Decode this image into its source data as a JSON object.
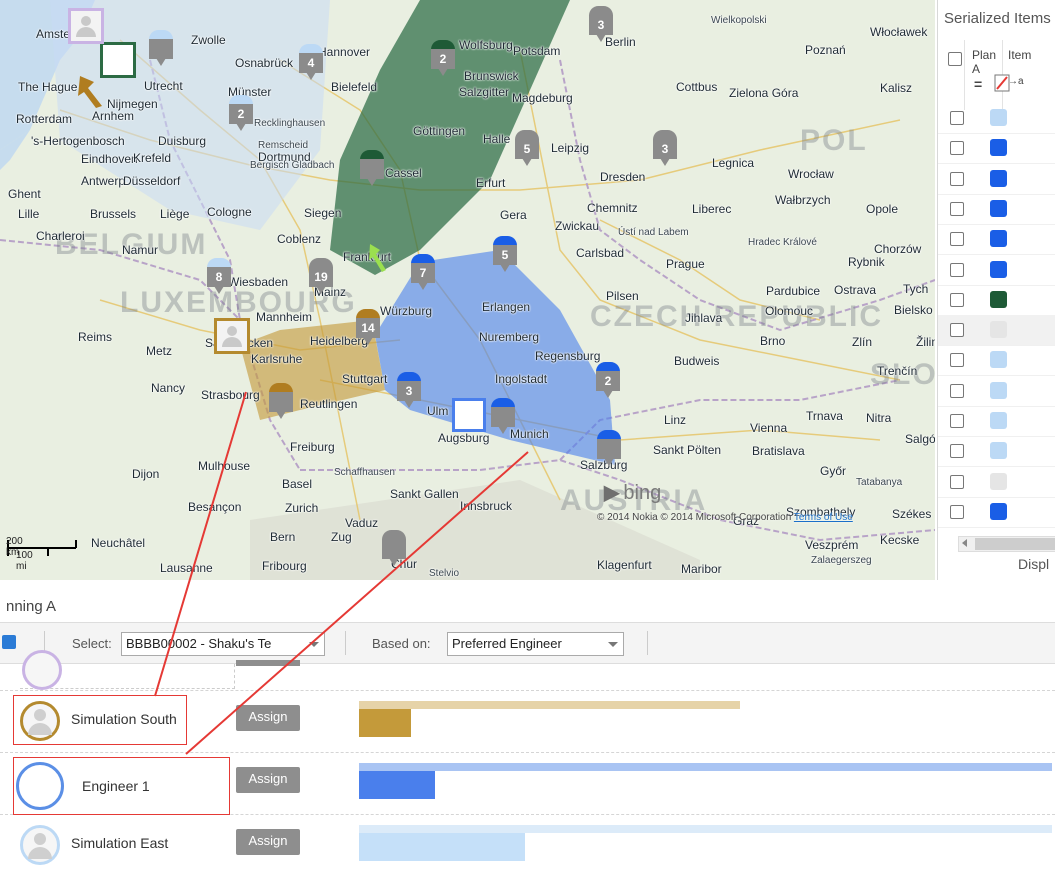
{
  "map": {
    "countries": [
      "BELGIUM",
      "LUXEMBOURG",
      "CZECH REPUBLIC",
      "AUSTRIA",
      "POL",
      "SLOV"
    ],
    "cities": [
      {
        "name": "Amsterdam",
        "cls": ""
      },
      {
        "name": "Zwolle",
        "cls": ""
      },
      {
        "name": "The Hague",
        "cls": ""
      },
      {
        "name": "Utrecht",
        "cls": ""
      },
      {
        "name": "Nijmegen",
        "cls": ""
      },
      {
        "name": "Rotterdam",
        "cls": ""
      },
      {
        "name": "Arnhem",
        "cls": ""
      },
      {
        "name": "Osnabrück",
        "cls": ""
      },
      {
        "name": "Hannover",
        "cls": ""
      },
      {
        "name": "Bielefeld",
        "cls": ""
      },
      {
        "name": "Münster",
        "cls": ""
      },
      {
        "name": "Wolfsburg",
        "cls": ""
      },
      {
        "name": "Potsdam",
        "cls": ""
      },
      {
        "name": "Berlin",
        "cls": ""
      },
      {
        "name": "Brunswick",
        "cls": ""
      },
      {
        "name": "Salzgitter",
        "cls": ""
      },
      {
        "name": "Magdeburg",
        "cls": ""
      },
      {
        "name": "Poznań",
        "cls": ""
      },
      {
        "name": "Włocławek",
        "cls": ""
      },
      {
        "name": "Wielkopolski",
        "cls": "small"
      },
      {
        "name": "Zielona Góra",
        "cls": ""
      },
      {
        "name": "Kalisz",
        "cls": ""
      },
      {
        "name": "Cottbus",
        "cls": ""
      },
      {
        "name": "'s-Hertogenbosch",
        "cls": ""
      },
      {
        "name": "Duisburg",
        "cls": ""
      },
      {
        "name": "Recklinghausen",
        "cls": "small"
      },
      {
        "name": "Göttingen",
        "cls": ""
      },
      {
        "name": "Halle",
        "cls": ""
      },
      {
        "name": "Leipzig",
        "cls": ""
      },
      {
        "name": "Eindhoven",
        "cls": ""
      },
      {
        "name": "Krefeld",
        "cls": ""
      },
      {
        "name": "Dortmund",
        "cls": ""
      },
      {
        "name": "Remscheid",
        "cls": "small"
      },
      {
        "name": "Cassel",
        "cls": ""
      },
      {
        "name": "Erfurt",
        "cls": ""
      },
      {
        "name": "Dresden",
        "cls": ""
      },
      {
        "name": "Legnica",
        "cls": ""
      },
      {
        "name": "Wrocław",
        "cls": ""
      },
      {
        "name": "Antwerp",
        "cls": ""
      },
      {
        "name": "Düsseldorf",
        "cls": ""
      },
      {
        "name": "Bergisch Gladbach",
        "cls": "small"
      },
      {
        "name": "Ghent",
        "cls": ""
      },
      {
        "name": "Lille",
        "cls": ""
      },
      {
        "name": "Brussels",
        "cls": ""
      },
      {
        "name": "Liège",
        "cls": ""
      },
      {
        "name": "Cologne",
        "cls": ""
      },
      {
        "name": "Siegen",
        "cls": ""
      },
      {
        "name": "Gera",
        "cls": ""
      },
      {
        "name": "Chemnitz",
        "cls": ""
      },
      {
        "name": "Liberec",
        "cls": ""
      },
      {
        "name": "Wałbrzych",
        "cls": ""
      },
      {
        "name": "Opole",
        "cls": ""
      },
      {
        "name": "Charleroi",
        "cls": ""
      },
      {
        "name": "Namur",
        "cls": ""
      },
      {
        "name": "Coblenz",
        "cls": ""
      },
      {
        "name": "Zwickau",
        "cls": ""
      },
      {
        "name": "Ústí nad Labem",
        "cls": "small"
      },
      {
        "name": "Hradec Králové",
        "cls": "small"
      },
      {
        "name": "Chorzów",
        "cls": ""
      },
      {
        "name": "Rybnik",
        "cls": ""
      },
      {
        "name": "Carlsbad",
        "cls": ""
      },
      {
        "name": "Prague",
        "cls": ""
      },
      {
        "name": "Wiesbaden",
        "cls": ""
      },
      {
        "name": "Mainz",
        "cls": ""
      },
      {
        "name": "Frankfurt",
        "cls": ""
      },
      {
        "name": "Pardubice",
        "cls": ""
      },
      {
        "name": "Ostrava",
        "cls": ""
      },
      {
        "name": "Tych",
        "cls": ""
      },
      {
        "name": "Würzburg",
        "cls": ""
      },
      {
        "name": "Erlangen",
        "cls": ""
      },
      {
        "name": "Pilsen",
        "cls": ""
      },
      {
        "name": "Olomouc",
        "cls": ""
      },
      {
        "name": "Bielsko",
        "cls": ""
      },
      {
        "name": "Mannheim",
        "cls": ""
      },
      {
        "name": "Heidelberg",
        "cls": ""
      },
      {
        "name": "Nuremberg",
        "cls": ""
      },
      {
        "name": "Jihlava",
        "cls": ""
      },
      {
        "name": "Brno",
        "cls": ""
      },
      {
        "name": "Zlín",
        "cls": ""
      },
      {
        "name": "Žilin",
        "cls": ""
      },
      {
        "name": "Reims",
        "cls": ""
      },
      {
        "name": "Metz",
        "cls": ""
      },
      {
        "name": "Saarbrücken",
        "cls": ""
      },
      {
        "name": "Karlsruhe",
        "cls": ""
      },
      {
        "name": "Regensburg",
        "cls": ""
      },
      {
        "name": "Budweis",
        "cls": ""
      },
      {
        "name": "Nancy",
        "cls": ""
      },
      {
        "name": "Strasbourg",
        "cls": ""
      },
      {
        "name": "Stuttgart",
        "cls": ""
      },
      {
        "name": "Ingolstadt",
        "cls": ""
      },
      {
        "name": "Trenčín",
        "cls": ""
      },
      {
        "name": "Reutlingen",
        "cls": ""
      },
      {
        "name": "Ulm",
        "cls": ""
      },
      {
        "name": "Linz",
        "cls": ""
      },
      {
        "name": "Trnava",
        "cls": ""
      },
      {
        "name": "Nitra",
        "cls": ""
      },
      {
        "name": "Vienna",
        "cls": ""
      },
      {
        "name": "Salgó",
        "cls": ""
      },
      {
        "name": "Augsburg",
        "cls": ""
      },
      {
        "name": "Munich",
        "cls": ""
      },
      {
        "name": "Freiburg",
        "cls": ""
      },
      {
        "name": "Sankt Pölten",
        "cls": ""
      },
      {
        "name": "Bratislava",
        "cls": ""
      },
      {
        "name": "Mulhouse",
        "cls": ""
      },
      {
        "name": "Schaffhausen",
        "cls": "small"
      },
      {
        "name": "Salzburg",
        "cls": ""
      },
      {
        "name": "Győr",
        "cls": ""
      },
      {
        "name": "Tatabanya",
        "cls": "small"
      },
      {
        "name": "Dijon",
        "cls": ""
      },
      {
        "name": "Basel",
        "cls": ""
      },
      {
        "name": "Sankt Gallen",
        "cls": ""
      },
      {
        "name": "Besançon",
        "cls": ""
      },
      {
        "name": "Zurich",
        "cls": ""
      },
      {
        "name": "Innsbruck",
        "cls": ""
      },
      {
        "name": "Szombathely",
        "cls": ""
      },
      {
        "name": "Székes",
        "cls": ""
      },
      {
        "name": "Vaduz",
        "cls": ""
      },
      {
        "name": "Neuchâtel",
        "cls": ""
      },
      {
        "name": "Bern",
        "cls": ""
      },
      {
        "name": "Zug",
        "cls": ""
      },
      {
        "name": "Chur",
        "cls": ""
      },
      {
        "name": "Graz",
        "cls": ""
      },
      {
        "name": "Veszprém",
        "cls": ""
      },
      {
        "name": "Kecske",
        "cls": ""
      },
      {
        "name": "Lausanne",
        "cls": ""
      },
      {
        "name": "Fribourg",
        "cls": ""
      },
      {
        "name": "Stelvio",
        "cls": "small"
      },
      {
        "name": "Klagenfurt",
        "cls": ""
      },
      {
        "name": "Maribor",
        "cls": ""
      },
      {
        "name": "Zalaegerszeg",
        "cls": "small"
      }
    ],
    "pins": [
      {
        "label": "3",
        "color": "#8b8b8b"
      },
      {
        "label": "",
        "color": "#bcd9f5"
      },
      {
        "label": "4",
        "color": "#bcd9f5"
      },
      {
        "label": "2",
        "color": "#1e5a36"
      },
      {
        "label": "2",
        "color": "#bcd9f5"
      },
      {
        "label": "",
        "color": "#1e5a36"
      },
      {
        "label": "5",
        "color": "#8b8b8b"
      },
      {
        "label": "3",
        "color": "#8b8b8b"
      },
      {
        "label": "8",
        "color": "#bcd9f5"
      },
      {
        "label": "19",
        "color": "#8b8b8b"
      },
      {
        "label": "7",
        "color": "#1a5ee6"
      },
      {
        "label": "5",
        "color": "#1a5ee6"
      },
      {
        "label": "14",
        "color": "#b07d20"
      },
      {
        "label": "2",
        "color": "#1a5ee6"
      },
      {
        "label": "3",
        "color": "#1a5ee6"
      },
      {
        "label": "",
        "color": "#b07d20"
      },
      {
        "label": "",
        "color": "#1a5ee6"
      },
      {
        "label": "",
        "color": "#1a5ee6"
      },
      {
        "label": "",
        "color": "#8b8b8b"
      }
    ],
    "bing_logo": "bing",
    "copyright": "© 2014 Nokia © 2014 Microsoft Corporation",
    "terms_link": "Terms of Use",
    "scale_km": "200 km",
    "scale_mi": "100 mi"
  },
  "right_panel": {
    "title": "Serialized Items",
    "col_plan": "Plan A",
    "col_item": "Item",
    "col_item_sub": "→a",
    "filter_icon": "filter-lines-icon",
    "clear_filter_icon": "clear-filter-icon",
    "rows": [
      {
        "color": "#bcd9f5",
        "highlight": false
      },
      {
        "color": "#1a5ee6",
        "highlight": false
      },
      {
        "color": "#1a5ee6",
        "highlight": false
      },
      {
        "color": "#1a5ee6",
        "highlight": false
      },
      {
        "color": "#1a5ee6",
        "highlight": false
      },
      {
        "color": "#1a5ee6",
        "highlight": false
      },
      {
        "color": "#1e5a36",
        "highlight": false
      },
      {
        "color": "#e5e5e5",
        "highlight": true
      },
      {
        "color": "#bcd9f5",
        "highlight": false
      },
      {
        "color": "#bcd9f5",
        "highlight": false
      },
      {
        "color": "#bcd9f5",
        "highlight": false
      },
      {
        "color": "#bcd9f5",
        "highlight": false
      },
      {
        "color": "#e5e5e5",
        "highlight": false
      },
      {
        "color": "#1a5ee6",
        "highlight": false
      }
    ],
    "footer": "Displ"
  },
  "planning": {
    "title": "nning A",
    "select_label": "Select:",
    "select_value": "BBBB00002 - Shaku's Te",
    "based_on_label": "Based on:",
    "based_on_value": "Preferred Engineer"
  },
  "engineers": [
    {
      "name": "Simulation South",
      "assign": "Assign",
      "ring": "#b48a2e",
      "light": "#e6d3a8",
      "dark": "#c49a3a",
      "light_frac": 0.55,
      "dark_frac": 0.075,
      "avatar_style": "person"
    },
    {
      "name": "Engineer 1",
      "assign": "Assign",
      "ring": "#5b8fe6",
      "light": "#a9c4f3",
      "dark": "#4a7fec",
      "light_frac": 1.0,
      "dark_frac": 0.11,
      "avatar_style": "ring"
    },
    {
      "name": "Simulation East",
      "assign": "Assign",
      "ring": "#bcd9f5",
      "light": "#dcebf9",
      "dark": "#c5e0f9",
      "light_frac": 1.0,
      "dark_frac": 0.24,
      "avatar_style": "person"
    }
  ],
  "colors": {
    "accent_blue": "#1a5ee6",
    "south_gold": "#b48a2e",
    "green_region": "#1e5a36",
    "light_blue": "#bcd9f5",
    "annotation_red": "#e53935"
  }
}
